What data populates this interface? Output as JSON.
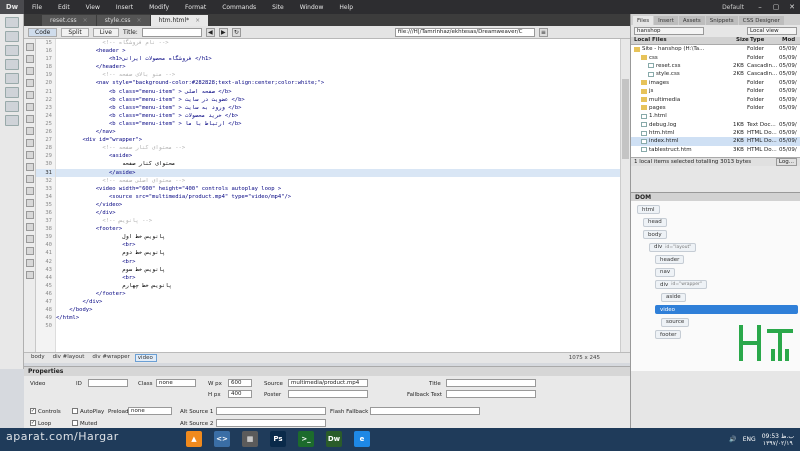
{
  "app": {
    "logo": "Dw",
    "menu": [
      "File",
      "Edit",
      "View",
      "Insert",
      "Modify",
      "Format",
      "Commands",
      "Site",
      "Window",
      "Help"
    ],
    "workspace": "Default",
    "window_controls": [
      "–",
      "▢",
      "✕"
    ]
  },
  "doc_tabs": [
    {
      "label": "reset.css",
      "active": false
    },
    {
      "label": "style.css",
      "active": false
    },
    {
      "label": "htm.html*",
      "active": true
    }
  ],
  "doc_toolbar": {
    "views": [
      "Code",
      "Split",
      "Live"
    ],
    "title_label": "Title:",
    "url": "file:///H|/Tamrinhaz/ekhtesas/Dreamweaver/C"
  },
  "code": {
    "current_line": 31,
    "lines": [
      {
        "n": 15,
        "text": "              <!-- نام فروشگاه -->",
        "kind": "cmt"
      },
      {
        "n": 16,
        "text": "            <header >",
        "kind": "tag"
      },
      {
        "n": 17,
        "text": "                <h1>فروشگاه محصولات ایرانی </h1>",
        "kind": "tag"
      },
      {
        "n": 18,
        "text": "            </header>",
        "kind": "tag"
      },
      {
        "n": 19,
        "text": "              <!-- منو بالای صفحه -->",
        "kind": "cmt"
      },
      {
        "n": 20,
        "text": "            <nav style=\"background-color:#282828;text-align:center;color:white;\">",
        "kind": "tag"
      },
      {
        "n": 21,
        "text": "                <b class=\"menu-item\" > صفحه اصلی </b>",
        "kind": "tag"
      },
      {
        "n": 22,
        "text": "                <b class=\"menu-item\" > عضویت در سایت </b>",
        "kind": "tag"
      },
      {
        "n": 23,
        "text": "                <b class=\"menu-item\" > ورود به سایت </b>",
        "kind": "tag"
      },
      {
        "n": 24,
        "text": "                <b class=\"menu-item\" > خرید محصولات </b>",
        "kind": "tag"
      },
      {
        "n": 25,
        "text": "                <b class=\"menu-item\" > ارتباط با ما </b>",
        "kind": "tag"
      },
      {
        "n": 26,
        "text": "            </nav>",
        "kind": "tag"
      },
      {
        "n": 27,
        "text": "        <div id=\"wrapper\">",
        "kind": "tag"
      },
      {
        "n": 28,
        "text": "              <!-- محتوای کنار صفحه -->",
        "kind": "cmt"
      },
      {
        "n": 29,
        "text": "                <aside>",
        "kind": "tag"
      },
      {
        "n": 30,
        "text": "                    محتوای کنار صفحه",
        "kind": "txt"
      },
      {
        "n": 31,
        "text": "                </aside>",
        "kind": "tag"
      },
      {
        "n": 32,
        "text": "              <!-- محتوای اصلی صفحه -->",
        "kind": "cmt"
      },
      {
        "n": 33,
        "text": "            <video width=\"600\" height=\"400\" controls autoplay loop >",
        "kind": "tag"
      },
      {
        "n": 34,
        "text": "                <source src=\"multimedia/product.mp4\" type=\"video/mp4\"/>",
        "kind": "tag"
      },
      {
        "n": 35,
        "text": "            </video>",
        "kind": "tag"
      },
      {
        "n": 36,
        "text": "            </div>",
        "kind": "tag"
      },
      {
        "n": 37,
        "text": "              <!-- پانویس -->",
        "kind": "cmt"
      },
      {
        "n": 38,
        "text": "            <footer>",
        "kind": "tag"
      },
      {
        "n": 39,
        "text": "                    پانویس خط اول",
        "kind": "txt"
      },
      {
        "n": 40,
        "text": "                    <br>",
        "kind": "tag"
      },
      {
        "n": 41,
        "text": "                    پانویس خط دوم",
        "kind": "txt"
      },
      {
        "n": 42,
        "text": "                    <br>",
        "kind": "tag"
      },
      {
        "n": 43,
        "text": "                    پانویس خط سوم",
        "kind": "txt"
      },
      {
        "n": 44,
        "text": "                    <br>",
        "kind": "tag"
      },
      {
        "n": 45,
        "text": "                    پانویس خط چهارم",
        "kind": "txt"
      },
      {
        "n": 46,
        "text": "            </footer>",
        "kind": "tag"
      },
      {
        "n": 47,
        "text": "        </div>",
        "kind": "tag"
      },
      {
        "n": 48,
        "text": "    </body>",
        "kind": "tag"
      },
      {
        "n": 49,
        "text": "</html>",
        "kind": "tag"
      },
      {
        "n": 50,
        "text": "",
        "kind": "tag"
      }
    ]
  },
  "status": {
    "breadcrumbs": [
      "body",
      "div #layout",
      "div #wrapper",
      "video"
    ],
    "selected_crumb": 3,
    "doc_size": "1075 x 245"
  },
  "properties": {
    "header": "Properties",
    "type": "Video",
    "id_label": "ID",
    "class_label": "Class",
    "class_value": "none",
    "w_label": "W px",
    "w_value": "600",
    "h_label": "H px",
    "h_value": "400",
    "source_label": "Source",
    "source_value": "multimedia/product.mp4",
    "title_label": "Title",
    "poster_label": "Poster",
    "fallback_text_label": "Fallback Text",
    "controls_label": "Controls",
    "autoplay_label": "AutoPlay",
    "preload_label": "Preload",
    "preload_value": "none",
    "alt_source1_label": "Alt Source 1",
    "alt_source2_label": "Alt Source 2",
    "flash_fallback_label": "Flash Fallback",
    "loop_label": "Loop",
    "muted_label": "Muted",
    "controls_checked": true,
    "autoplay_checked": false,
    "loop_checked": true,
    "muted_checked": false
  },
  "files_panel": {
    "tabs": [
      "Files",
      "Insert",
      "Assets",
      "Snippets",
      "CSS Designer"
    ],
    "site": "hanshop",
    "view": "Local view",
    "columns": [
      "Local Files",
      "Size",
      "Type",
      "Mod"
    ],
    "rows": [
      {
        "name": "Site - hanshop (H:\\Ta...",
        "size": "",
        "type": "Folder",
        "mod": "05/09/",
        "kind": "folder",
        "indent": 0,
        "selected": false
      },
      {
        "name": "css",
        "size": "",
        "type": "Folder",
        "mod": "05/09/",
        "kind": "folder",
        "indent": 1,
        "selected": false
      },
      {
        "name": "reset.css",
        "size": "2KB",
        "type": "Cascadin...",
        "mod": "05/09/",
        "kind": "file",
        "indent": 2,
        "selected": false
      },
      {
        "name": "style.css",
        "size": "2KB",
        "type": "Cascadin...",
        "mod": "05/09/",
        "kind": "file",
        "indent": 2,
        "selected": false
      },
      {
        "name": "images",
        "size": "",
        "type": "Folder",
        "mod": "05/09/",
        "kind": "folder",
        "indent": 1,
        "selected": false
      },
      {
        "name": "js",
        "size": "",
        "type": "Folder",
        "mod": "05/09/",
        "kind": "folder",
        "indent": 1,
        "selected": false
      },
      {
        "name": "multimedia",
        "size": "",
        "type": "Folder",
        "mod": "05/09/",
        "kind": "folder",
        "indent": 1,
        "selected": false
      },
      {
        "name": "pages",
        "size": "",
        "type": "Folder",
        "mod": "05/09/",
        "kind": "folder",
        "indent": 1,
        "selected": false
      },
      {
        "name": "1.html",
        "size": "",
        "type": "",
        "mod": "",
        "kind": "file",
        "indent": 1,
        "selected": false
      },
      {
        "name": "debug.log",
        "size": "1KB",
        "type": "Text Doc...",
        "mod": "05/09/",
        "kind": "file",
        "indent": 1,
        "selected": false
      },
      {
        "name": "htm.html",
        "size": "2KB",
        "type": "HTML Do...",
        "mod": "05/09/",
        "kind": "file",
        "indent": 1,
        "selected": false
      },
      {
        "name": "index.html",
        "size": "2KB",
        "type": "HTML Do...",
        "mod": "05/09/",
        "kind": "file",
        "indent": 1,
        "selected": true
      },
      {
        "name": "tablestruct.htm",
        "size": "3KB",
        "type": "HTML Do...",
        "mod": "05/09/",
        "kind": "file",
        "indent": 1,
        "selected": false
      }
    ],
    "status_text": "1 local items selected totalling 3013 bytes",
    "log_button": "Log..."
  },
  "dom_panel": {
    "header": "DOM",
    "nodes": [
      {
        "tag": "html",
        "attr": "",
        "selected": false
      },
      {
        "tag": "head",
        "attr": "",
        "selected": false
      },
      {
        "tag": "body",
        "attr": "",
        "selected": false
      },
      {
        "tag": "div",
        "attr": "id=\"layout\"",
        "selected": false
      },
      {
        "tag": "header",
        "attr": "",
        "selected": false
      },
      {
        "tag": "nav",
        "attr": "",
        "selected": false
      },
      {
        "tag": "div",
        "attr": "id=\"wrapper\"",
        "selected": false
      },
      {
        "tag": "aside",
        "attr": "",
        "selected": false
      },
      {
        "tag": "video",
        "attr": "",
        "selected": true
      },
      {
        "tag": "source",
        "attr": "",
        "selected": false
      },
      {
        "tag": "footer",
        "attr": "",
        "selected": false
      }
    ]
  },
  "taskbar": {
    "watermark": "aparat.com/Hargar",
    "icons": [
      {
        "name": "vlc",
        "label": "▲",
        "color": "#f08a1d"
      },
      {
        "name": "code",
        "label": "<>",
        "color": "#3a6ea5"
      },
      {
        "name": "calc",
        "label": "▦",
        "color": "#5b5b5b"
      },
      {
        "name": "photoshop",
        "label": "Ps",
        "color": "#0a2a4a"
      },
      {
        "name": "terminal",
        "label": ">_",
        "color": "#1c6b2c"
      },
      {
        "name": "dreamweaver",
        "label": "Dw",
        "color": "#2a5c2a"
      },
      {
        "name": "ie",
        "label": "e",
        "color": "#1e88e5"
      }
    ],
    "lang": "ENG",
    "time": "09:53 ب.ظ",
    "date": "۱۳۹۷/۰۲/۱۹"
  }
}
